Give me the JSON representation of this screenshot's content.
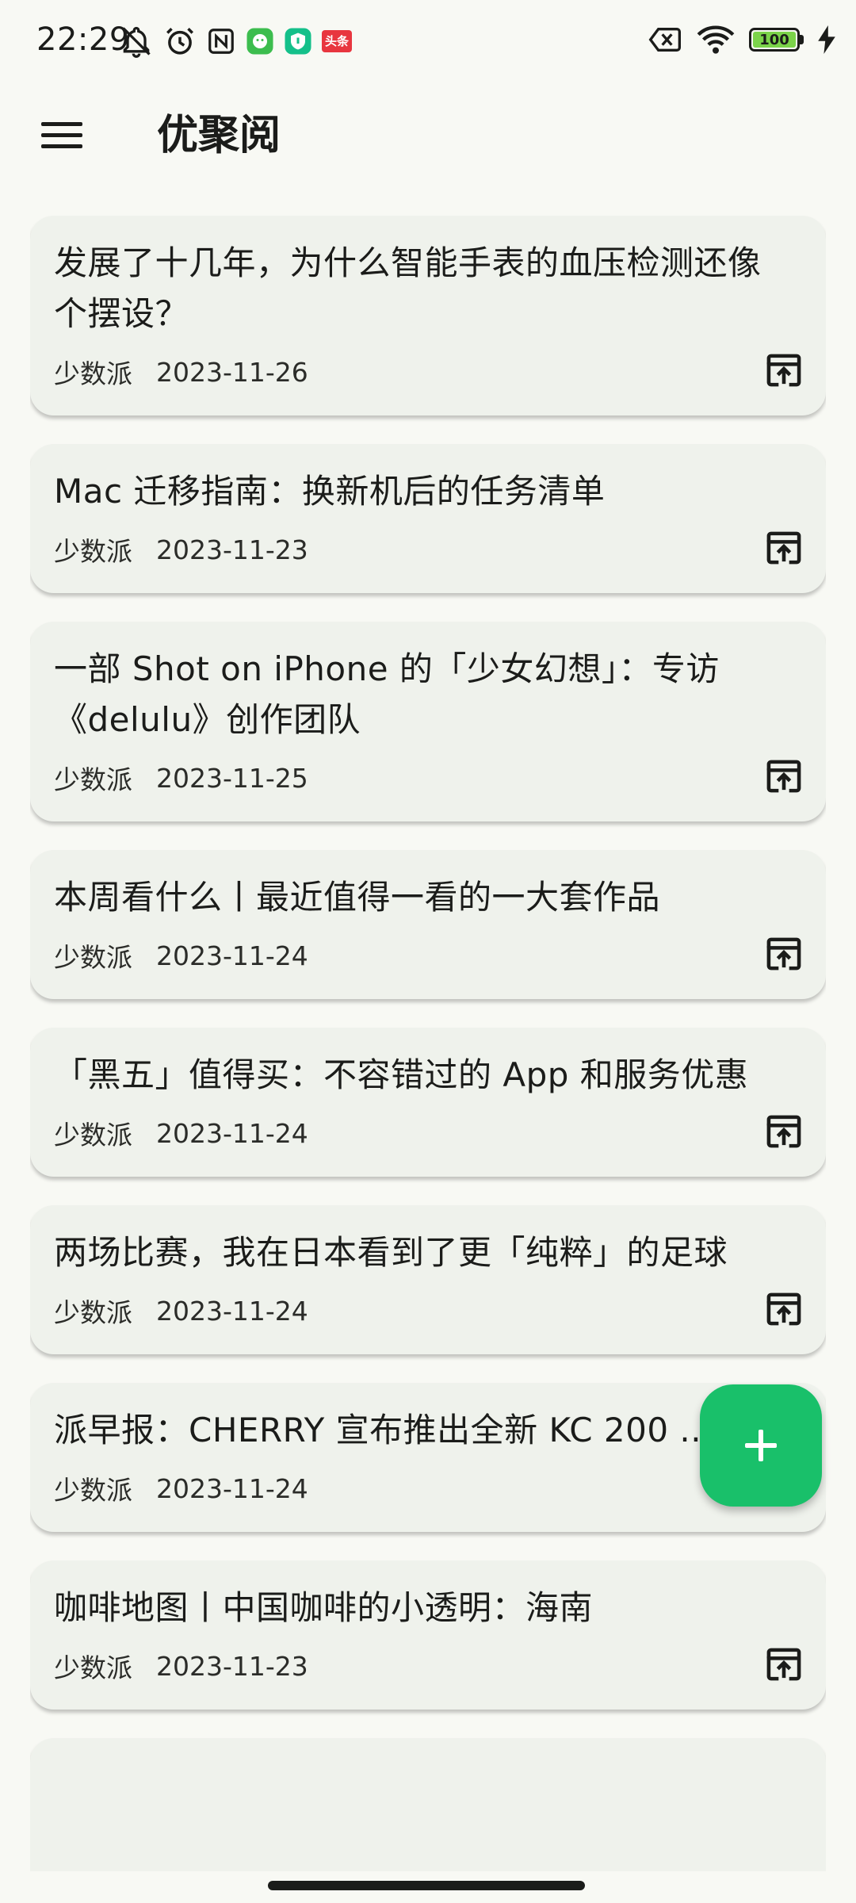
{
  "status_bar": {
    "time": "22:29",
    "battery_level": "100",
    "battery_fraction": 1.0,
    "left_icons": [
      "mute-icon",
      "alarm-icon",
      "nfc-icon",
      "app-notification-green-icon",
      "app-notification-shield-icon",
      "app-notification-toutiao-icon"
    ],
    "right_icons": [
      "no-sim-icon",
      "wifi-icon",
      "battery-icon",
      "charging-icon"
    ],
    "toutiao_label": "头条"
  },
  "app_bar": {
    "title": "优聚阅",
    "menu_icon": "hamburger-menu-icon"
  },
  "articles": [
    {
      "title": "发展了十几年，为什么智能手表的血压检测还像个摆设？",
      "source": "少数派",
      "date": "2023-11-26"
    },
    {
      "title": "Mac 迁移指南：换新机后的任务清单",
      "source": "少数派",
      "date": "2023-11-23"
    },
    {
      "title": "一部 Shot on iPhone 的「少女幻想」：专访《delulu》创作团队",
      "source": "少数派",
      "date": "2023-11-25"
    },
    {
      "title": "本周看什么丨最近值得一看的一大套作品",
      "source": "少数派",
      "date": "2023-11-24"
    },
    {
      "title": "「黑五」值得买：不容错过的 App 和服务优惠",
      "source": "少数派",
      "date": "2023-11-24"
    },
    {
      "title": "两场比赛，我在日本看到了更「纯粹」的足球",
      "source": "少数派",
      "date": "2023-11-24"
    },
    {
      "title": "派早报：CHERRY 宣布推出全新 KC 200 ... 盘",
      "source": "少数派",
      "date": "2023-11-24"
    },
    {
      "title": "咖啡地图丨中国咖啡的小透明：海南",
      "source": "少数派",
      "date": "2023-11-23"
    },
    {
      "title": "",
      "source": "",
      "date": ""
    }
  ],
  "fab": {
    "icon": "plus-icon",
    "color": "#19c06a"
  },
  "colors": {
    "background": "#f8f9f4",
    "card": "#eff2ec",
    "accent": "#19c06a",
    "text": "#1b1c1a"
  }
}
